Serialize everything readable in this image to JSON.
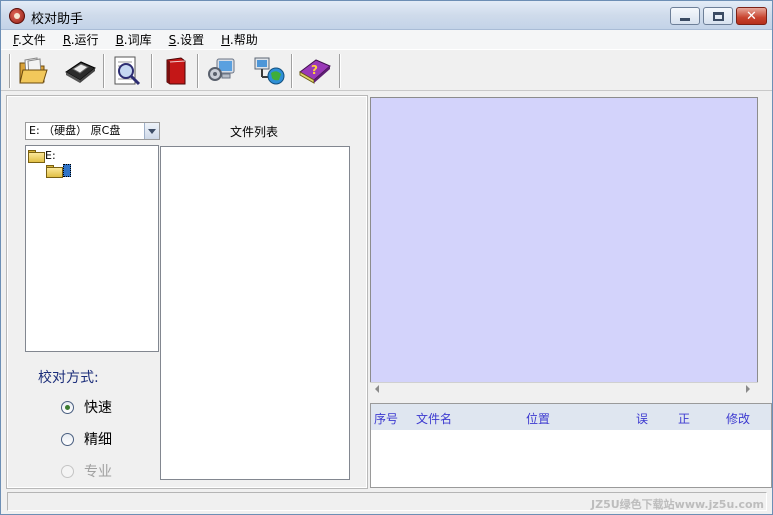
{
  "window": {
    "title": "校对助手"
  },
  "menu": [
    {
      "key": "F",
      "label": ".文件"
    },
    {
      "key": "R",
      "label": ".运行"
    },
    {
      "key": "B",
      "label": ".词库"
    },
    {
      "key": "S",
      "label": ".设置"
    },
    {
      "key": "H",
      "label": ".帮助"
    }
  ],
  "toolbar": {
    "buttons": [
      "open-folder-icon",
      "save-disk-icon",
      "search-doc-icon",
      "red-book-icon",
      "settings-computer-icon",
      "network-icon",
      "help-book-icon"
    ]
  },
  "left_panel": {
    "drive_select": "E: （硬盘） 原C盘",
    "file_list_label": "文件列表",
    "tree": {
      "root": "E:"
    },
    "mode_label": "校对方式:",
    "modes": [
      {
        "label": "快速",
        "checked": true,
        "disabled": false
      },
      {
        "label": "精细",
        "checked": false,
        "disabled": false
      },
      {
        "label": "专业",
        "checked": false,
        "disabled": true
      }
    ]
  },
  "results": {
    "columns": [
      "序号",
      "文件名",
      "位置",
      "误",
      "正",
      "修改"
    ]
  },
  "status": {
    "watermark": "JZ5U绿色下载站www.jz5u.com"
  },
  "colors": {
    "preview_bg": "#d3d3fb",
    "column_text": "#3d3ad0"
  }
}
